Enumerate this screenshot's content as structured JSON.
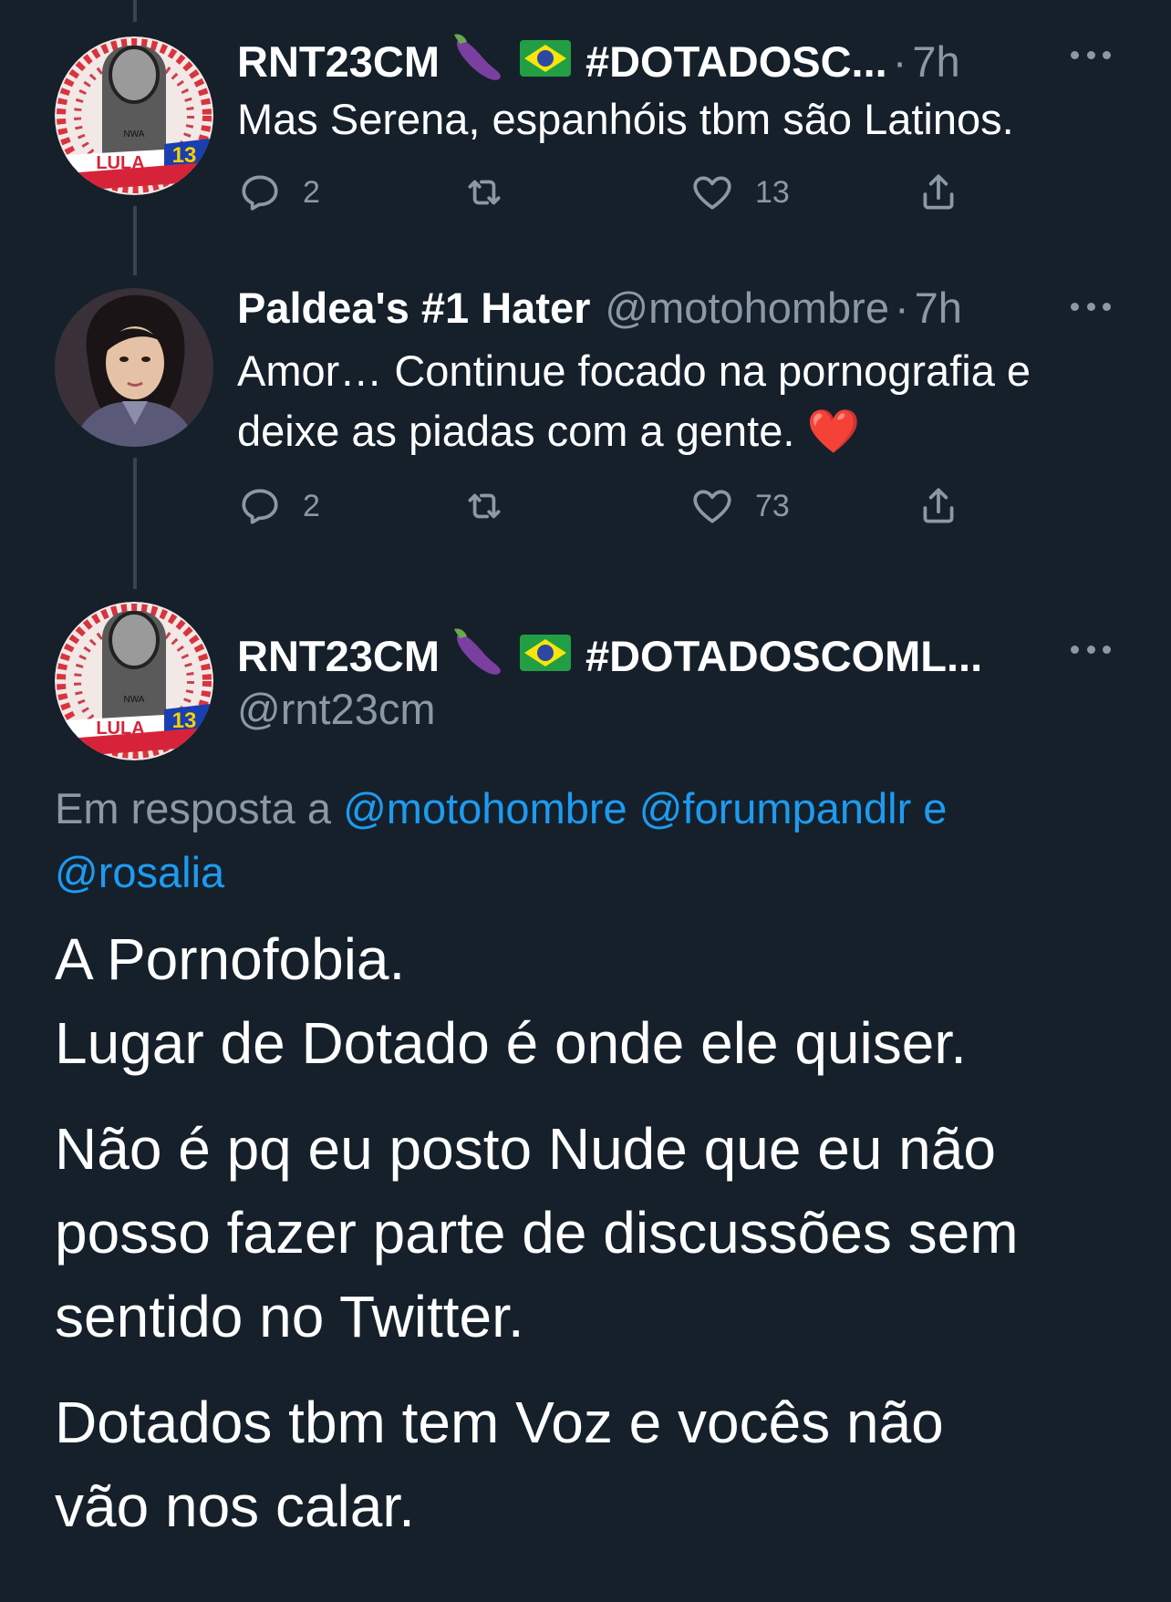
{
  "tweets": [
    {
      "name": "RNT23CM",
      "emoji": "🍆🇧🇷",
      "hashtag": "#DOTADOSC...",
      "dot": "·",
      "time": "7h",
      "text": "Mas Serena, espanhóis tbm são Latinos.",
      "replies": "2",
      "likes": "13",
      "avatar_badge": "LULA",
      "avatar_number": "13",
      "avatar_tag": "NWA"
    },
    {
      "name": "Paldea's #1 Hater",
      "handle": "@motohombre",
      "dot": "·",
      "time": "7h",
      "text_line1": "Amor… Continue focado na pornografia e",
      "text_line2": "deixe as piadas com a gente.",
      "heart": "❤️",
      "replies": "2",
      "likes": "73"
    }
  ],
  "main_tweet": {
    "name": "RNT23CM",
    "emoji": "🍆🇧🇷",
    "hashtag": "#DOTADOSCOML...",
    "handle": "@rnt23cm",
    "reply_prefix": "Em resposta a",
    "reply_mention1": "@motohombre",
    "reply_mention2": "@forumpandlr",
    "reply_and": "e",
    "reply_mention3": "@rosalia",
    "paragraphs": [
      "A Pornofobia.",
      "Lugar de Dotado é onde ele quiser.",
      "Não é pq eu posto Nude que eu não",
      "posso fazer parte de discussões sem",
      "sentido no Twitter.",
      "Dotados tbm tem Voz e vocês não",
      "vão nos calar."
    ]
  },
  "colors": {
    "background": "#15202b",
    "secondary_text": "#8b98a5",
    "link": "#1d9bf0",
    "thread_line": "#38444d"
  },
  "icons": [
    "reply-icon",
    "retweet-icon",
    "like-icon",
    "share-icon",
    "more-icon",
    "eggplant-icon",
    "brazil-flag-icon"
  ]
}
